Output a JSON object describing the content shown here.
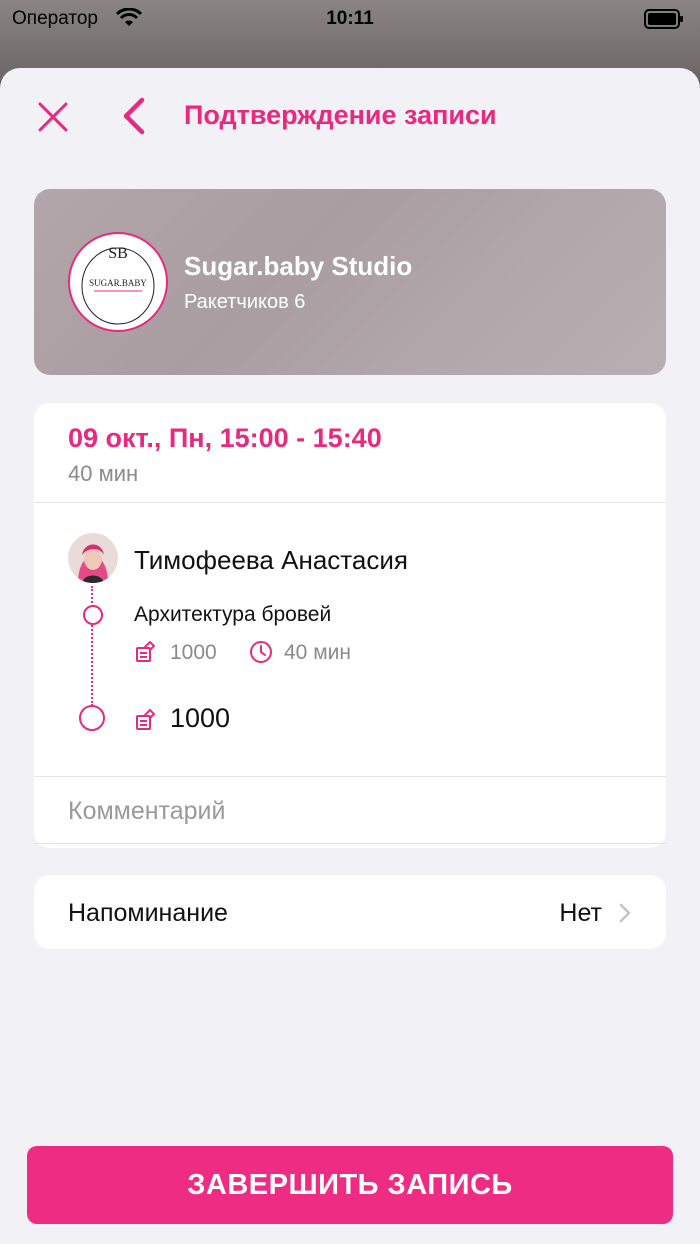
{
  "status_bar": {
    "carrier": "Оператор",
    "time": "10:11"
  },
  "nav": {
    "title": "Подтверждение записи",
    "close_icon": "close-icon",
    "back_icon": "chevron-left-icon"
  },
  "studio": {
    "name": "Sugar.baby Studio",
    "address": "Ракетчиков 6",
    "logo_letters": "SB",
    "logo_text": "SUGAR.BABY"
  },
  "appointment": {
    "datetime": "09 окт., Пн, 15:00 - 15:40",
    "duration": "40 мин",
    "master_name": "Тимофеева Анастасия",
    "service": {
      "name": "Архитектура бровей",
      "price": "1000",
      "duration": "40 мин"
    },
    "total_price": "1000",
    "comment_placeholder": "Комментарий"
  },
  "reminder": {
    "label": "Напоминание",
    "value": "Нет"
  },
  "finish_button": {
    "label": "ЗАВЕРШИТЬ ЗАПИСЬ"
  },
  "colors": {
    "accent": "#e8297f",
    "button": "#ee2c83",
    "background": "#f2f1f6",
    "muted_text": "#8a8a8e"
  }
}
